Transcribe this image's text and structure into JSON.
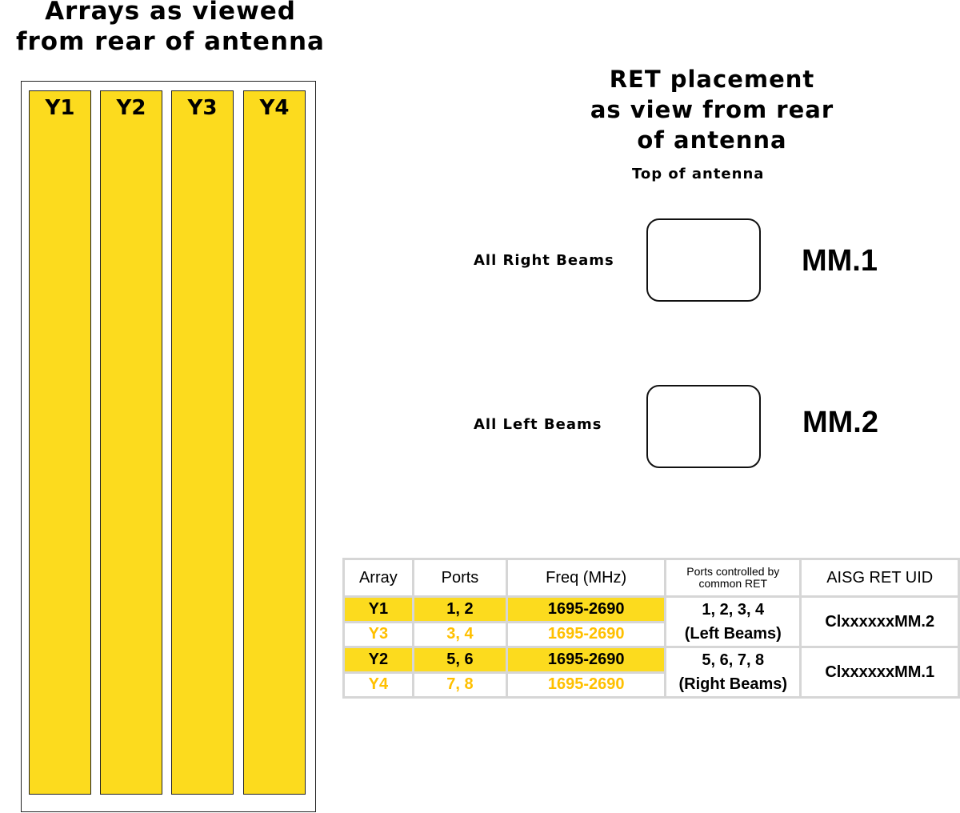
{
  "left": {
    "title_line1": "Arrays as viewed",
    "title_line2": "from rear of antenna",
    "arrays": [
      "Y1",
      "Y2",
      "Y3",
      "Y4"
    ]
  },
  "right": {
    "title_line1": "RET placement",
    "title_line2": "as view from rear",
    "title_line3": "of antenna",
    "subtitle": "Top of antenna",
    "rets": [
      {
        "label": "All Right Beams",
        "name": "MM.1"
      },
      {
        "label": "All Left Beams",
        "name": "MM.2"
      }
    ]
  },
  "table": {
    "headers": [
      "Array",
      "Ports",
      "Freq (MHz)",
      "Ports controlled by common RET",
      "AISG RET UID"
    ],
    "rows": [
      {
        "array": "Y1",
        "ports": "1, 2",
        "freq": "1695-2690"
      },
      {
        "array": "Y3",
        "ports": "3, 4",
        "freq": "1695-2690"
      },
      {
        "array": "Y2",
        "ports": "5, 6",
        "freq": "1695-2690"
      },
      {
        "array": "Y4",
        "ports": "7, 8",
        "freq": "1695-2690"
      }
    ],
    "groups": [
      {
        "ports": "1, 2, 3, 4",
        "beams": "(Left Beams)",
        "uid": "ClxxxxxxMM.2"
      },
      {
        "ports": "5, 6, 7, 8",
        "beams": "(Right Beams)",
        "uid": "ClxxxxxxMM.1"
      }
    ]
  },
  "colors": {
    "array_yellow": "#FCDB1E",
    "orange_text": "#FFC000",
    "grid": "#d6d6d6"
  }
}
